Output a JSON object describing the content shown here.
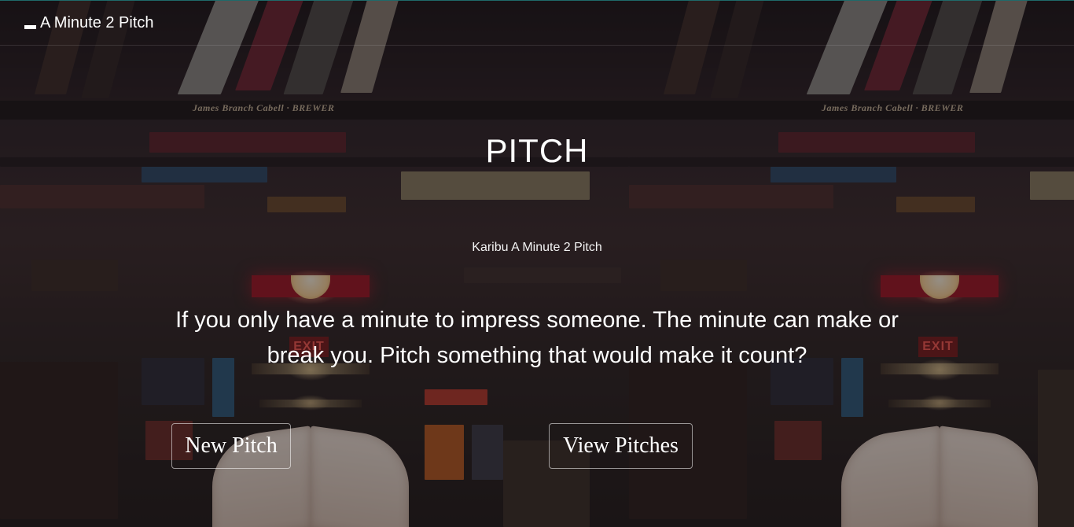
{
  "navbar": {
    "brand_label": "A Minute 2 Pitch",
    "brand_icon": "menu-bar-icon"
  },
  "hero": {
    "title": "PITCH",
    "subtitle": "Karibu A Minute 2 Pitch",
    "tagline": "If you only have a minute to impress someone. The minute can make or break you. Pitch something that would make it count?"
  },
  "actions": {
    "new_pitch_label": "New Pitch",
    "view_pitches_label": "View Pitches"
  },
  "background": {
    "spine_text": "James Branch Cabell · BREWER",
    "exit_sign": "EXIT"
  },
  "colors": {
    "text": "#ffffff",
    "navbar_top_border": "#1f6a6a"
  }
}
